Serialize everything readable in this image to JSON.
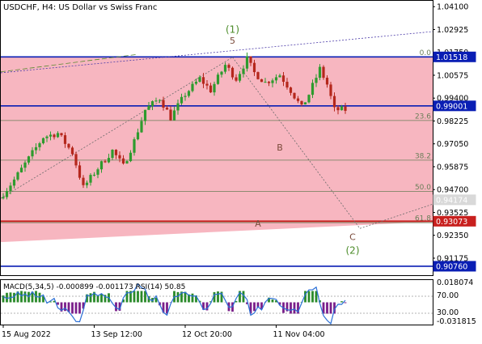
{
  "chart_data": [
    {
      "type": "candlestick",
      "title": "USDCHF, H4:  US Dollar vs Swiss Franc",
      "symbol": "USDCHF",
      "timeframe": "H4",
      "ylim": [
        0.903,
        1.044
      ],
      "y_ticks": [
        "1.04100",
        "1.02925",
        "1.01750",
        "1.00575",
        "0.99400",
        "0.98225",
        "0.97050",
        "0.95875",
        "0.94700",
        "0.93525",
        "0.92350",
        "0.91175"
      ],
      "x_ticks": [
        "15 Aug 2022",
        "13 Sep 12:00",
        "12 Oct 20:00",
        "11 Nov 04:00"
      ],
      "x_tick_index": [
        0,
        25,
        50,
        75
      ],
      "n_bars": 95,
      "projection_index": 98,
      "colors": {
        "zone": "#f7b6c0",
        "up": "#2e9b2e",
        "down": "#b5271c",
        "level": "#0a1eb4",
        "current": "#c8201e",
        "wave": "#4c8c2a",
        "fib": "#6a7e58"
      },
      "price_path": [
        [
          0,
          0.9425
        ],
        [
          4,
          0.952
        ],
        [
          8,
          0.963
        ],
        [
          12,
          0.974
        ],
        [
          16,
          0.976
        ],
        [
          20,
          0.966
        ],
        [
          23,
          0.948
        ],
        [
          27,
          0.958
        ],
        [
          31,
          0.967
        ],
        [
          34,
          0.959
        ],
        [
          37,
          0.972
        ],
        [
          40,
          0.988
        ],
        [
          44,
          0.994
        ],
        [
          47,
          0.984
        ],
        [
          51,
          0.996
        ],
        [
          55,
          1.004
        ],
        [
          58,
          0.998
        ],
        [
          62,
          1.011
        ],
        [
          65,
          1.004
        ],
        [
          68,
          1.014
        ],
        [
          70,
          1.007
        ],
        [
          73,
          1.002
        ],
        [
          77,
          1.006
        ],
        [
          80,
          0.998
        ],
        [
          83,
          0.989
        ],
        [
          85,
          0.996
        ],
        [
          88,
          1.009
        ],
        [
          90,
          1.001
        ],
        [
          92,
          0.988
        ]
      ],
      "candles_note": "generated from price_path",
      "levels": [
        {
          "label": "0.0",
          "value": 1.01518,
          "tag": "1.01518"
        },
        {
          "label": "23.6",
          "value": 0.9825,
          "tag": null
        },
        {
          "label": "38.2",
          "value": 0.9621,
          "tag": null
        },
        {
          "label": "50.0",
          "value": 0.946,
          "tag": null
        },
        {
          "label": "61.8",
          "value": 0.93,
          "tag": null
        }
      ],
      "horizontal_lines": [
        {
          "value": 1.01518,
          "tag": "1.01518"
        },
        {
          "value": 0.99001,
          "tag": "0.99001"
        },
        {
          "value": 0.9076,
          "tag": "0.90760"
        }
      ],
      "current_price": {
        "value": 0.93073,
        "tag": "0.93073"
      },
      "ask_price": {
        "value": 0.94174,
        "tag": "0.94174"
      },
      "wave_labels": [
        {
          "text": "(1)",
          "index": 63,
          "value": 1.0275
        },
        {
          "text": "5",
          "index": 63,
          "value": 1.022
        },
        {
          "text": "B",
          "index": 76,
          "value": 0.967
        },
        {
          "text": "A",
          "index": 70,
          "value": 0.928
        },
        {
          "text": "C",
          "index": 96,
          "value": 0.921
        },
        {
          "text": "(2)",
          "index": 96,
          "value": 0.914
        }
      ]
    },
    {
      "type": "indicator",
      "title": "MACD(5,34,5) -0.000899 -0.001173 RSI(14) 50.85",
      "y_ticks": [
        "0.018074",
        "70.00",
        "30.00",
        "-0.031815"
      ]
    }
  ]
}
